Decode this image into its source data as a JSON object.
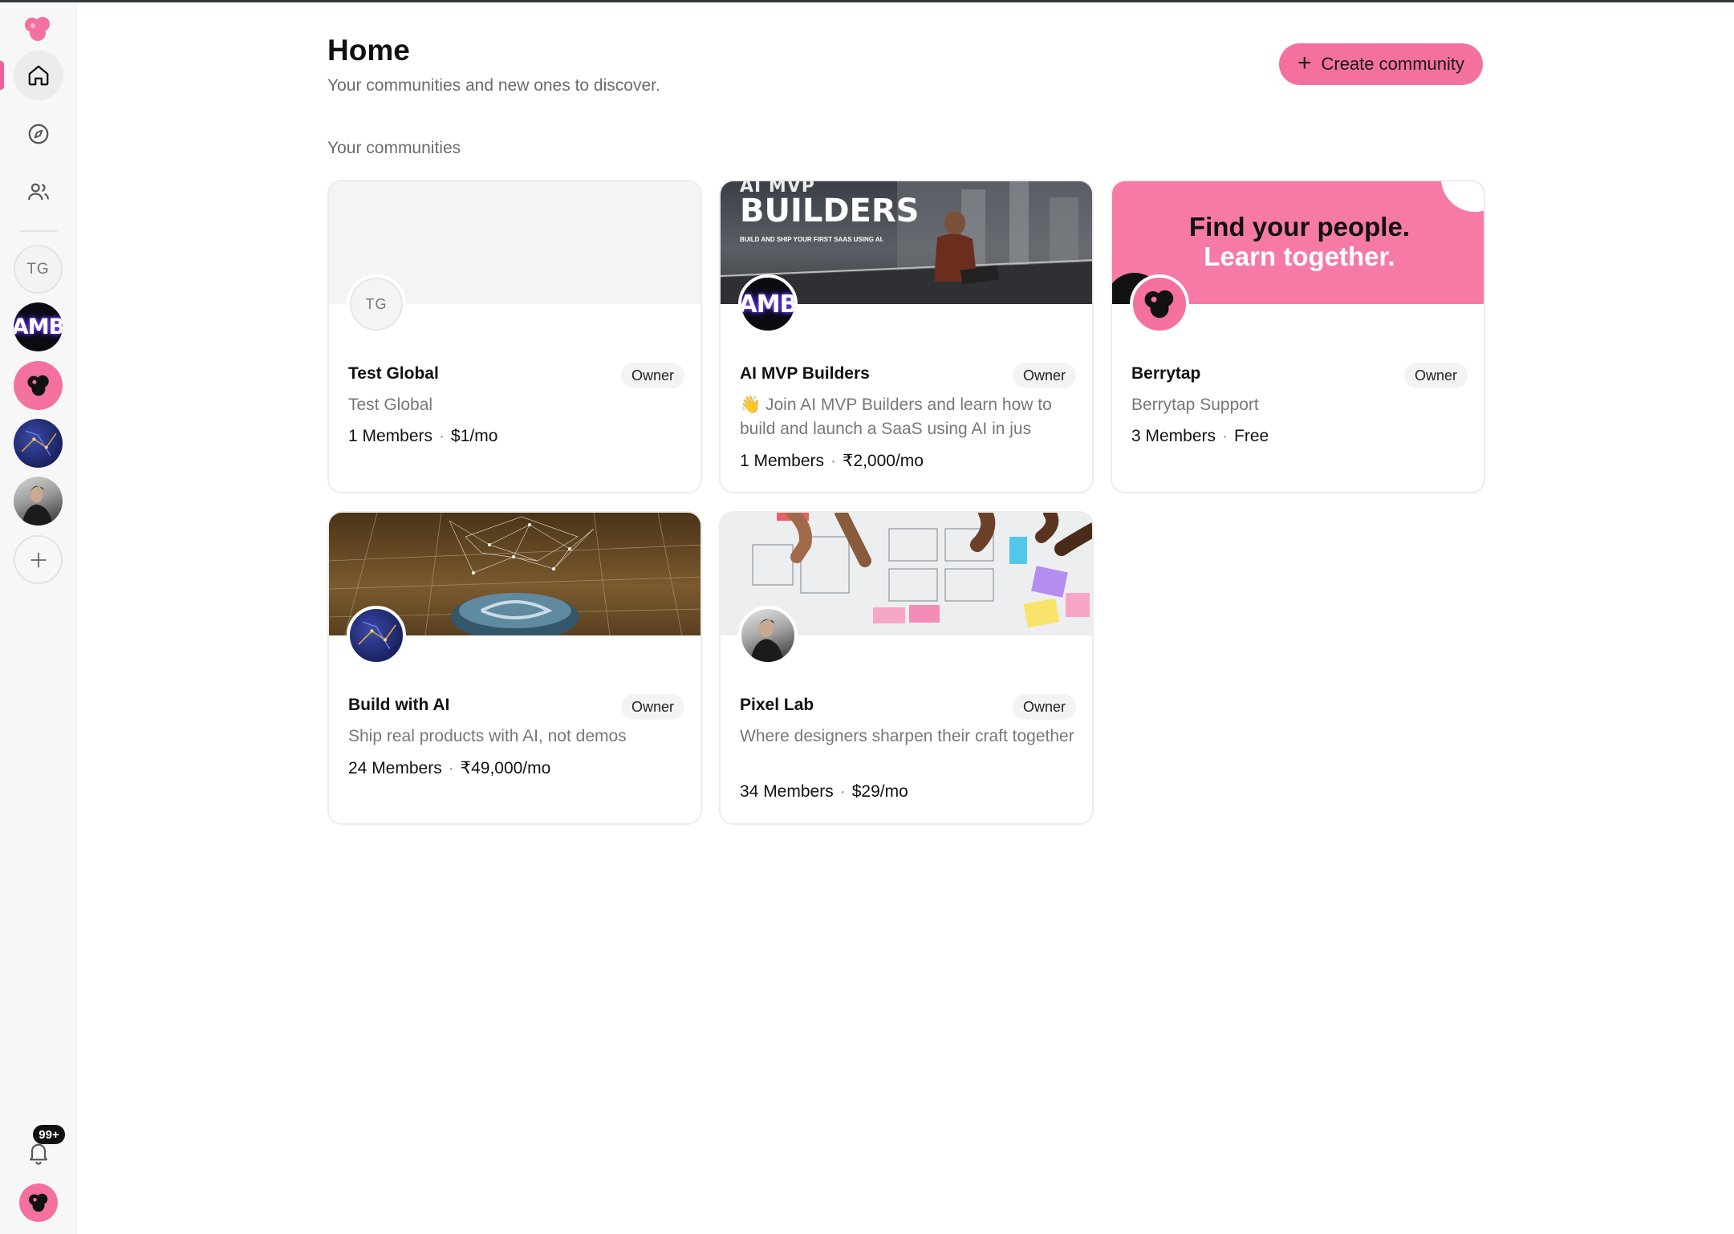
{
  "sidebar": {
    "nav": [
      {
        "icon": "home-icon",
        "active": true
      },
      {
        "icon": "compass-icon",
        "active": false
      },
      {
        "icon": "users-icon",
        "active": false
      }
    ],
    "communities": [
      {
        "initials": "TG"
      },
      {
        "initials": "AMB"
      },
      {
        "initials": ""
      },
      {
        "initials": ""
      },
      {
        "initials": ""
      }
    ],
    "notifications_badge": "99+"
  },
  "header": {
    "title": "Home",
    "subtitle": "Your communities and new ones to discover.",
    "create_label": "Create community"
  },
  "section": {
    "label": "Your communities"
  },
  "cards": [
    {
      "name": "Test Global",
      "role": "Owner",
      "description": "Test Global",
      "members": "1 Members",
      "price": "$1/mo",
      "avatar_initials": "TG"
    },
    {
      "name": "AI MVP Builders",
      "role": "Owner",
      "description": "👋 Join AI MVP Builders and learn how to build and launch a SaaS using AI in jus",
      "members": "1 Members",
      "price": "₹2,000/mo",
      "avatar_initials": "AMB",
      "cover_title": "BUILDERS",
      "cover_top": "AI MVP",
      "cover_sub": "BUILD AND SHIP YOUR FIRST SAAS USING AI."
    },
    {
      "name": "Berrytap",
      "role": "Owner",
      "description": "Berrytap Support",
      "members": "3 Members",
      "price": "Free",
      "cover_line1": "Find your people.",
      "cover_line2": "Learn together."
    },
    {
      "name": "Build with AI",
      "role": "Owner",
      "description": "Ship real products with AI, not demos",
      "members": "24 Members",
      "price": "₹49,000/mo"
    },
    {
      "name": "Pixel Lab",
      "role": "Owner",
      "description": "Where designers sharpen their craft together",
      "members": "34 Members",
      "price": "$29/mo"
    }
  ],
  "colors": {
    "accent": "#f4719f",
    "active_indicator": "#f0609a",
    "text_muted": "#6b6b6b"
  }
}
